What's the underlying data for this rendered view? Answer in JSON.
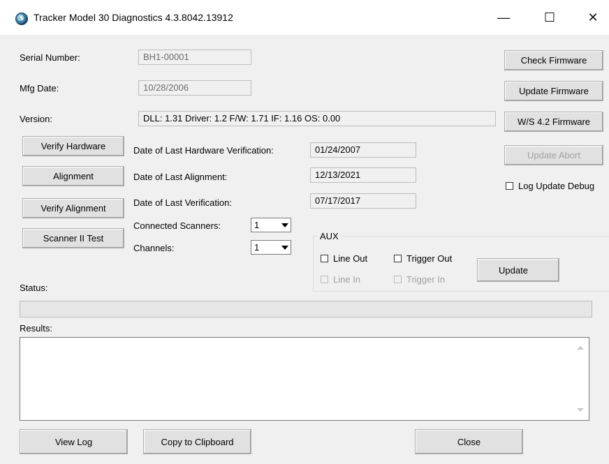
{
  "window": {
    "title": "Tracker Model 30 Diagnostics 4.3.8042.13912",
    "minimize_glyph": "—",
    "maximize_glyph": "☐",
    "close_glyph": "✕"
  },
  "info": {
    "serial_label": "Serial Number:",
    "serial_value": "BH1-00001",
    "mfg_label": "Mfg Date:",
    "mfg_value": "10/28/2006",
    "version_label": "Version:",
    "version_value": "DLL: 1.31  Driver: 1.2  F/W: 1.71 IF: 1.16  OS: 0.00"
  },
  "right_buttons": {
    "check_firmware": "Check Firmware",
    "update_firmware": "Update Firmware",
    "ws_firmware": "W/S 4.2 Firmware",
    "update_abort": "Update Abort",
    "log_update_debug": "Log Update Debug"
  },
  "left_buttons": {
    "verify_hardware": "Verify Hardware",
    "alignment": "Alignment",
    "verify_alignment": "Verify Alignment",
    "scanner_test": "Scanner II Test"
  },
  "dates": {
    "hw_verification_label": "Date of Last Hardware Verification:",
    "hw_verification_value": "01/24/2007",
    "alignment_label": "Date of Last Alignment:",
    "alignment_value": "12/13/2021",
    "verification_label": "Date of Last Verification:",
    "verification_value": "07/17/2017"
  },
  "scanners": {
    "connected_label": "Connected Scanners:",
    "connected_value": "1",
    "channels_label": "Channels:",
    "channels_value": "1"
  },
  "aux": {
    "legend": "AUX",
    "line_out": "Line Out",
    "trigger_out": "Trigger Out",
    "line_in": "Line In",
    "trigger_in": "Trigger In",
    "update": "Update"
  },
  "status": {
    "label": "Status:"
  },
  "results": {
    "label": "Results:"
  },
  "bottom_buttons": {
    "view_log": "View Log",
    "copy_clipboard": "Copy to Clipboard",
    "close": "Close"
  },
  "colors": {
    "window_bg": "#f0f0f0",
    "button_bg": "#e1e1e1",
    "disabled_text": "#a0a0a0"
  },
  "icons": {
    "app": "tracker-app-icon",
    "combo_arrow": "chevron-down-icon",
    "scroll_up": "scroll-up-arrow",
    "scroll_down": "scroll-down-arrow"
  }
}
